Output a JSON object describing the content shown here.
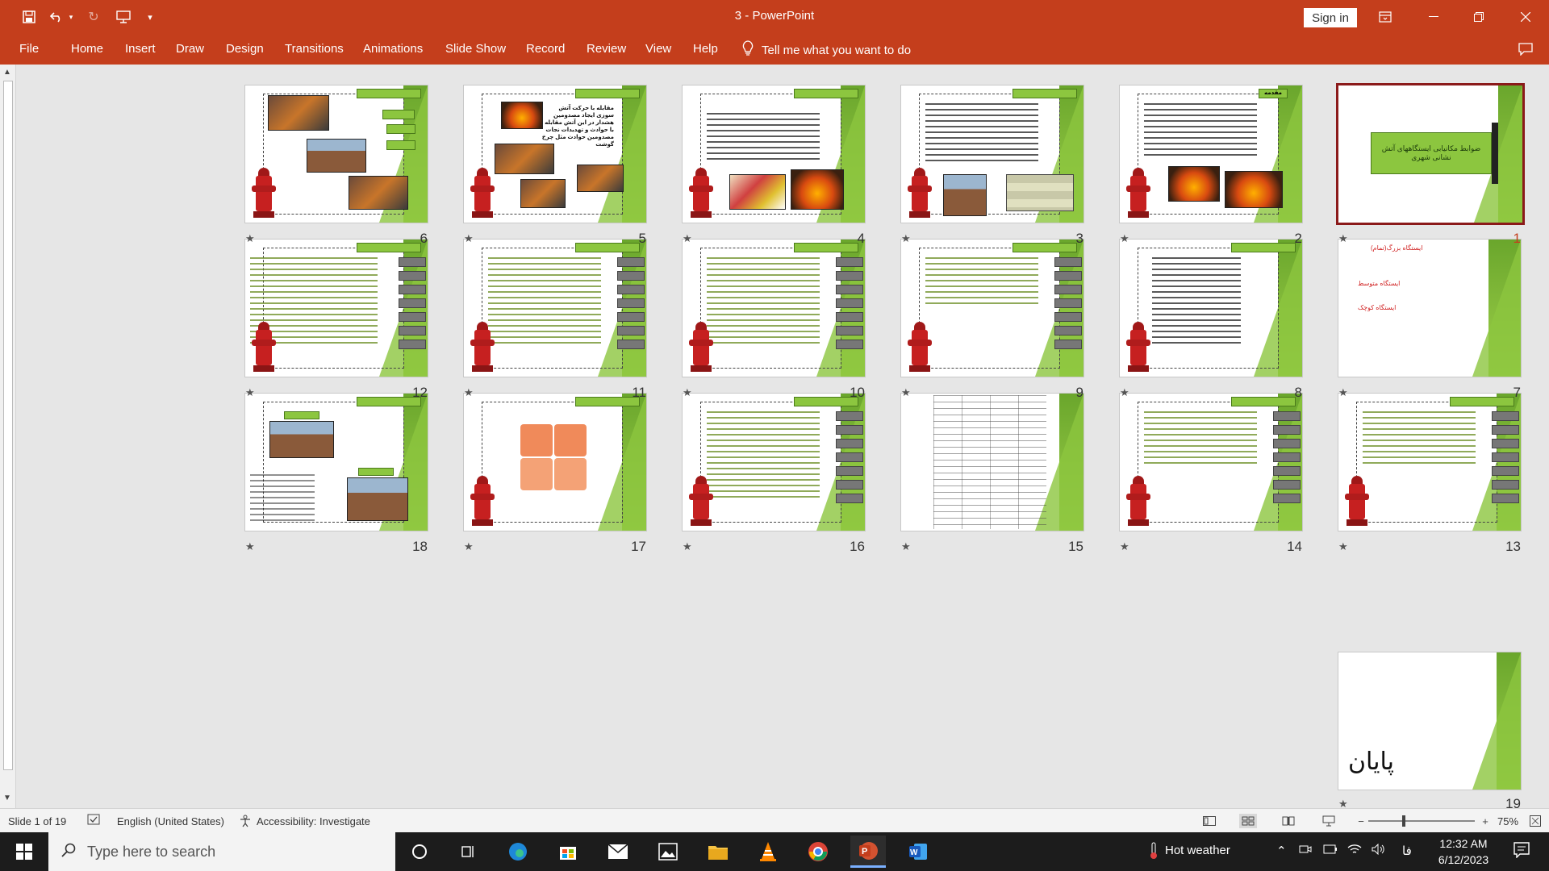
{
  "window": {
    "title": "3  -  PowerPoint",
    "sign_in": "Sign in"
  },
  "ribbon": {
    "tabs": [
      "File",
      "Home",
      "Insert",
      "Draw",
      "Design",
      "Transitions",
      "Animations",
      "Slide Show",
      "Record",
      "Review",
      "View",
      "Help"
    ],
    "tell_me": "Tell me what you want to do"
  },
  "slides": [
    {
      "num": "1",
      "title": "ضوابط مکانیابی ایستگاههای آتش نشانی شهری"
    },
    {
      "num": "2",
      "title": "مقدمه"
    },
    {
      "num": "3"
    },
    {
      "num": "4"
    },
    {
      "num": "5",
      "title": "مقابله با حرکت آتش سوزی ایجاد مصدومین هشدار در این آتش مقابله با حوادث و تهدیدات نجات مصدومین حوادث مثل چرخ گوشت"
    },
    {
      "num": "6"
    },
    {
      "num": "7",
      "labels": [
        "ایستگاه بزرگ(تمام)",
        "ایستگاه متوسط",
        "ایستگاه کوچک"
      ]
    },
    {
      "num": "8"
    },
    {
      "num": "9"
    },
    {
      "num": "10"
    },
    {
      "num": "11"
    },
    {
      "num": "12"
    },
    {
      "num": "13"
    },
    {
      "num": "14"
    },
    {
      "num": "15"
    },
    {
      "num": "16"
    },
    {
      "num": "17"
    },
    {
      "num": "18"
    },
    {
      "num": "19",
      "title": "پایان"
    }
  ],
  "status": {
    "slide_info": "Slide 1 of 19",
    "language": "English (United States)",
    "accessibility": "Accessibility: Investigate",
    "zoom": "75%"
  },
  "taskbar": {
    "search_placeholder": "Type here to search",
    "weather": "Hot weather",
    "lang": "فا",
    "time": "12:32 AM",
    "date": "6/12/2023"
  },
  "colors": {
    "accent": "#c43e1c",
    "slide_green": "#8cc63f",
    "selected_border": "#8b1a1a"
  },
  "icons": [
    "save-icon",
    "undo-icon",
    "redo-icon",
    "present-icon",
    "lightbulb-icon",
    "comments-icon",
    "windows-start-icon",
    "search-icon"
  ]
}
